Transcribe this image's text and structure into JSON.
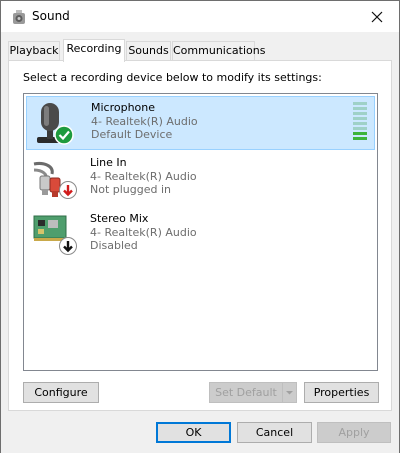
{
  "window": {
    "title": "Sound",
    "title_icon": "speaker-icon",
    "close_icon": "close-icon"
  },
  "tabs": [
    {
      "label": "Playback",
      "active": false
    },
    {
      "label": "Recording",
      "active": true
    },
    {
      "label": "Sounds",
      "active": false
    },
    {
      "label": "Communications",
      "active": false
    }
  ],
  "panel": {
    "instructions": "Select a recording device below to modify its settings:"
  },
  "devices": [
    {
      "name": "Microphone",
      "driver": "4- Realtek(R) Audio",
      "status": "Default Device",
      "icon": "microphone-icon",
      "badge": "green-check-icon",
      "selected": true,
      "level_fraction": 0.25
    },
    {
      "name": "Line In",
      "driver": "4- Realtek(R) Audio",
      "status": "Not plugged in",
      "icon": "line-in-icon",
      "badge": "red-down-arrow-icon",
      "selected": false
    },
    {
      "name": "Stereo Mix",
      "driver": "4- Realtek(R) Audio",
      "status": "Disabled",
      "icon": "sound-card-icon",
      "badge": "black-down-arrow-icon",
      "selected": false
    }
  ],
  "buttons": {
    "configure": "Configure",
    "set_default": "Set Default",
    "properties": "Properties",
    "ok": "OK",
    "cancel": "Cancel",
    "apply": "Apply"
  },
  "colors": {
    "selection": "#cce8ff",
    "accent": "#0078d7",
    "level_on": "#3cb43c",
    "level_off": "#9fd1c7"
  }
}
